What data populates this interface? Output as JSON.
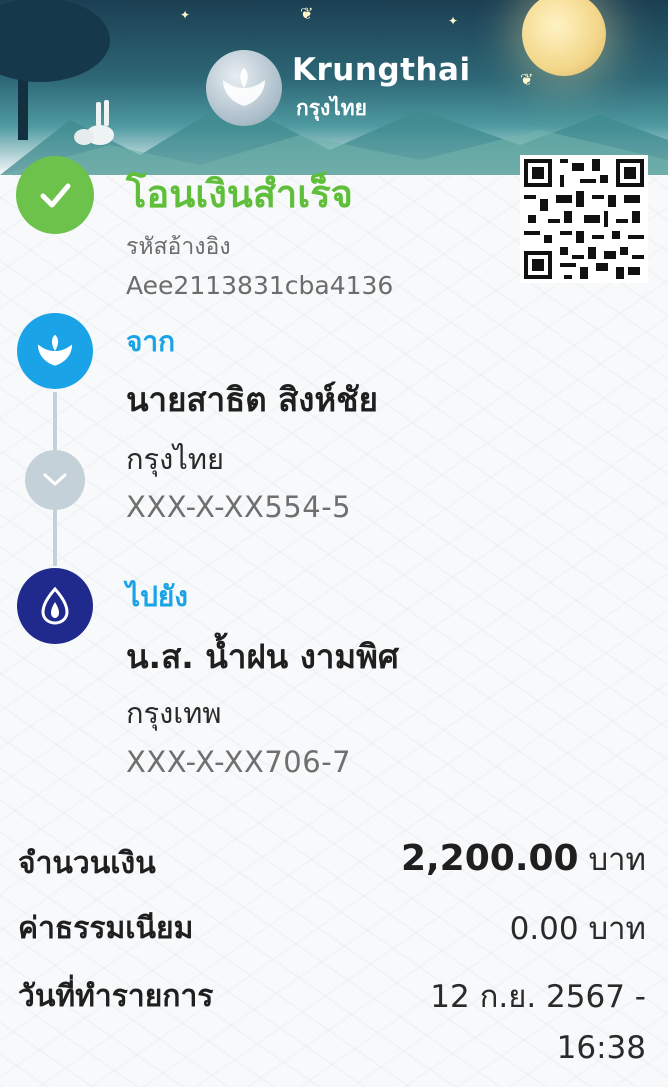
{
  "header": {
    "brand_en": "Krungthai",
    "brand_th": "กรุงไทย",
    "logo_icon": "krungthai-bird-logo-icon"
  },
  "status": {
    "icon": "check-icon",
    "text": "โอนเงินสำเร็จ",
    "ref_label": "รหัสอ้างอิง",
    "ref_value": "Aee2113831cba4136"
  },
  "from": {
    "label": "จาก",
    "name": "นายสาธิต สิงห์ชัย",
    "bank": "กรุงไทย",
    "account": "XXX-X-XX554-5",
    "icon": "krungthai-bank-icon"
  },
  "to": {
    "label": "ไปยัง",
    "name": "น.ส. น้ำฝน งามพิศ",
    "bank": "กรุงเทพ",
    "account": "XXX-X-XX706-7",
    "icon": "bangkok-bank-icon"
  },
  "details": {
    "amount_label": "จำนวนเงิน",
    "amount_value": "2,200.00",
    "amount_unit": "บาท",
    "fee_label": "ค่าธรรมเนียม",
    "fee_value": "0.00 บาท",
    "date_label": "วันที่ทำรายการ",
    "date_value": "12 ก.ย. 2567 -",
    "time_value": "16:38"
  },
  "colors": {
    "success_green": "#6cc24a",
    "krungthai_blue": "#1aa3e6",
    "bangkok_bank_navy": "#1f2a8c"
  }
}
